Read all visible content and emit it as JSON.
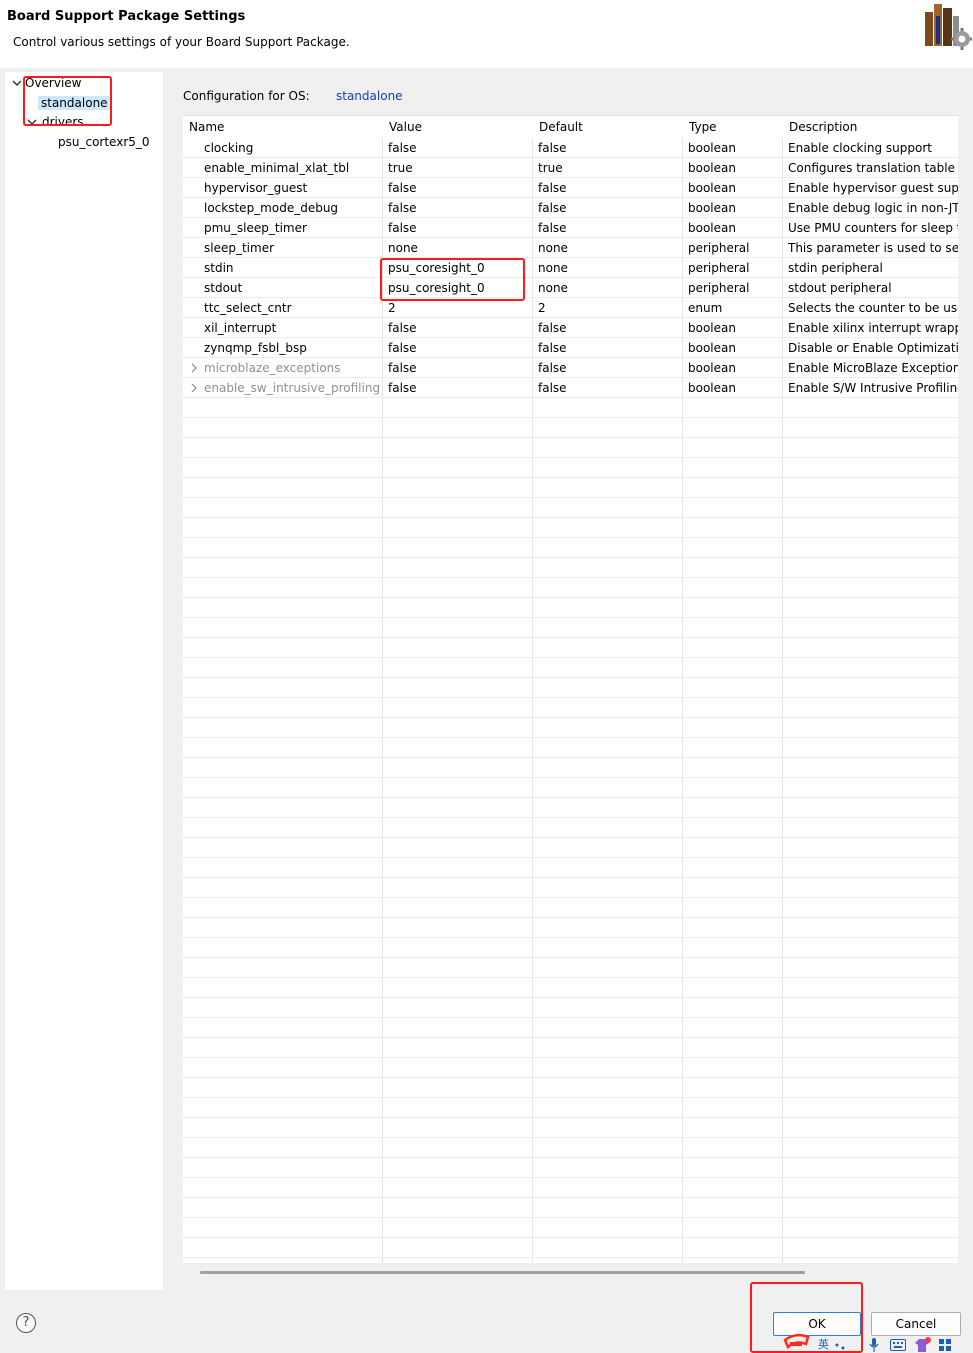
{
  "dialog": {
    "title": "Board Support Package Settings",
    "subtitle": "Control various settings of your Board Support Package."
  },
  "tree": {
    "overview": "Overview",
    "standalone": "standalone",
    "drivers": "drivers",
    "psu": "psu_cortexr5_0"
  },
  "config": {
    "label": "Configuration for OS:",
    "os": "standalone"
  },
  "table": {
    "columns": [
      "Name",
      "Value",
      "Default",
      "Type",
      "Description"
    ],
    "rows": [
      {
        "name": "clocking",
        "value": "false",
        "default": "false",
        "type": "boolean",
        "description": "Enable clocking support"
      },
      {
        "name": "enable_minimal_xlat_tbl",
        "value": "true",
        "default": "true",
        "type": "boolean",
        "description": "Configures translation table c"
      },
      {
        "name": "hypervisor_guest",
        "value": "false",
        "default": "false",
        "type": "boolean",
        "description": "Enable hypervisor guest supp"
      },
      {
        "name": "lockstep_mode_debug",
        "value": "false",
        "default": "false",
        "type": "boolean",
        "description": "Enable debug logic in non-JT"
      },
      {
        "name": "pmu_sleep_timer",
        "value": "false",
        "default": "false",
        "type": "boolean",
        "description": "Use PMU counters for sleep t"
      },
      {
        "name": "sleep_timer",
        "value": "none",
        "default": "none",
        "type": "peripheral",
        "description": "This parameter is used to sel"
      },
      {
        "name": "stdin",
        "value": "psu_coresight_0",
        "default": "none",
        "type": "peripheral",
        "description": "stdin peripheral"
      },
      {
        "name": "stdout",
        "value": "psu_coresight_0",
        "default": "none",
        "type": "peripheral",
        "description": "stdout peripheral"
      },
      {
        "name": "ttc_select_cntr",
        "value": "2",
        "default": "2",
        "type": "enum",
        "description": "Selects the counter to be use"
      },
      {
        "name": "xil_interrupt",
        "value": "false",
        "default": "false",
        "type": "boolean",
        "description": "Enable xilinx interrupt wrappe"
      },
      {
        "name": "zynqmp_fsbl_bsp",
        "value": "false",
        "default": "false",
        "type": "boolean",
        "description": "Disable or Enable Optimizatio"
      },
      {
        "name": "microblaze_exceptions",
        "value": "false",
        "default": "false",
        "type": "boolean",
        "description": "Enable MicroBlaze Exceptions"
      },
      {
        "name": "enable_sw_intrusive_profiling",
        "value": "false",
        "default": "false",
        "type": "boolean",
        "description": "Enable S/W Intrusive Profiling"
      }
    ]
  },
  "buttons": {
    "help": "?",
    "ok": "OK",
    "cancel": "Cancel"
  },
  "taskbar": {
    "ime_label": "英"
  },
  "colors": {
    "highlight": "#ff1a1a",
    "selection": "#cce8ff",
    "link": "#1a3bb5"
  }
}
